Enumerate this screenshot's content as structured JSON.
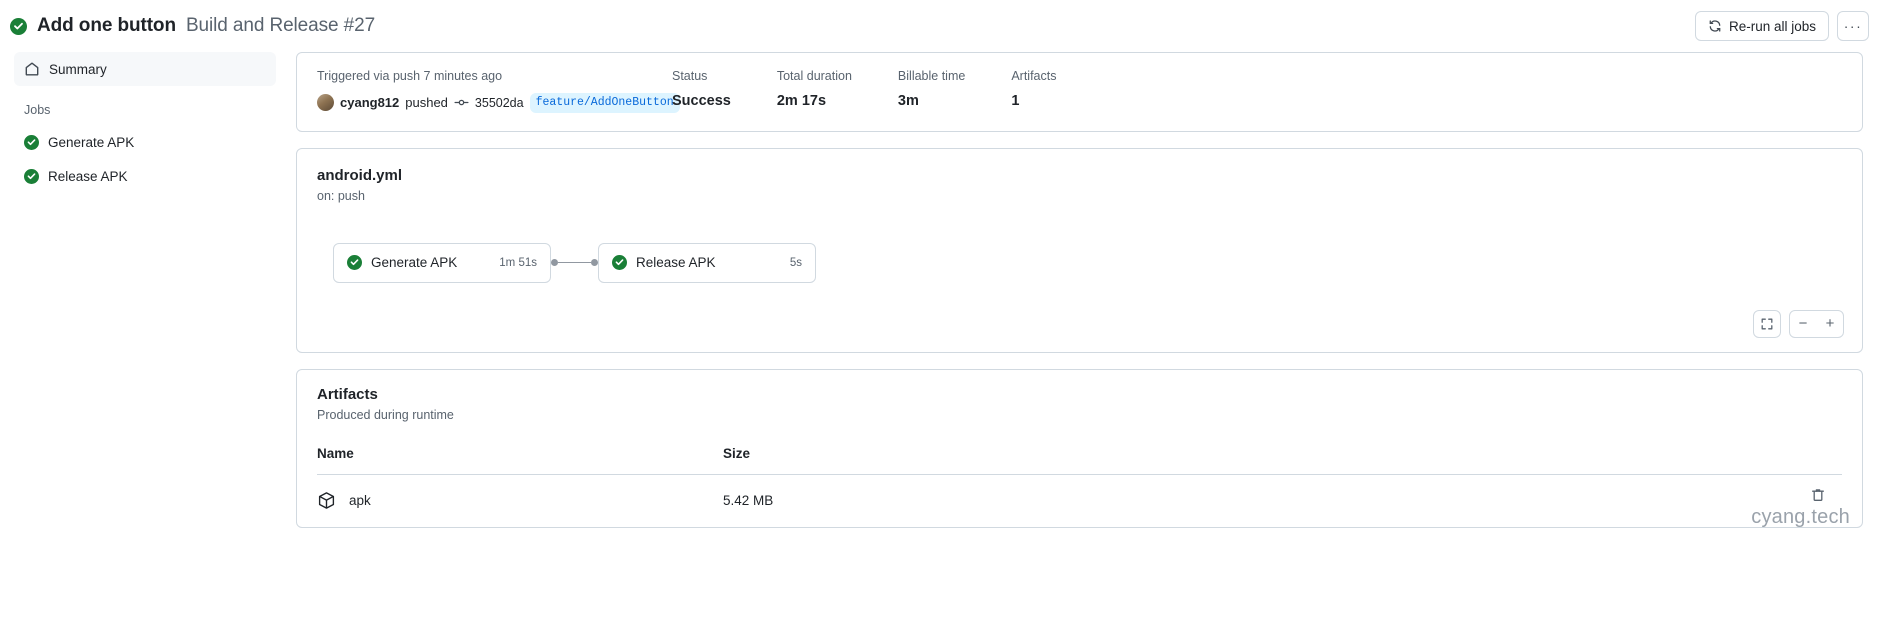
{
  "header": {
    "status_icon": "check-circle-icon",
    "title": "Add one button",
    "subtitle": "Build and Release #27",
    "rerun_label": "Re-run all jobs",
    "rerun_icon": "sync-icon",
    "kebab_label": "···"
  },
  "sidebar": {
    "summary_label": "Summary",
    "summary_icon": "home-icon",
    "jobs_label": "Jobs",
    "jobs": [
      {
        "label": "Generate APK",
        "icon": "check-circle-icon"
      },
      {
        "label": "Release APK",
        "icon": "check-circle-icon"
      }
    ]
  },
  "meta": {
    "trigger_text": "Triggered via push 7 minutes ago",
    "user": "cyang812",
    "action": "pushed",
    "commit_icon": "git-commit-icon",
    "sha": "35502da",
    "branch": "feature/AddOneButton",
    "stats": [
      {
        "label": "Status",
        "value": "Success"
      },
      {
        "label": "Total duration",
        "value": "2m 17s"
      },
      {
        "label": "Billable time",
        "value": "3m"
      },
      {
        "label": "Artifacts",
        "value": "1"
      }
    ]
  },
  "workflow": {
    "file": "android.yml",
    "trigger": "on: push",
    "nodes": [
      {
        "label": "Generate APK",
        "time": "1m 51s",
        "icon": "check-circle-icon"
      },
      {
        "label": "Release APK",
        "time": "5s",
        "icon": "check-circle-icon"
      }
    ],
    "controls": {
      "fullscreen_icon": "fullscreen-icon",
      "zoom_out_label": "−",
      "zoom_in_label": "+"
    }
  },
  "artifacts": {
    "title": "Artifacts",
    "subtitle": "Produced during runtime",
    "columns": {
      "name": "Name",
      "size": "Size"
    },
    "rows": [
      {
        "name": "apk",
        "size": "5.42 MB",
        "icon": "package-icon",
        "delete_icon": "trash-icon"
      }
    ]
  },
  "watermark": "cyang.tech",
  "colors": {
    "success_green": "#1a7f37",
    "accent_blue": "#0969da",
    "branch_bg": "#ddf4ff",
    "muted_text": "#59636e",
    "border": "#d1d9e0"
  }
}
